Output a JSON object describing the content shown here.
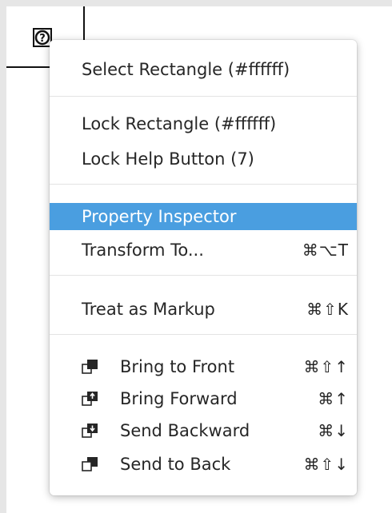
{
  "menu": {
    "items": [
      {
        "label": "Select Rectangle (#ffffff)",
        "shortcut": ""
      },
      {
        "label": "Lock Rectangle (#ffffff)",
        "shortcut": ""
      },
      {
        "label": "Lock Help Button (7)",
        "shortcut": ""
      },
      {
        "label": "Property Inspector",
        "shortcut": ""
      },
      {
        "label": "Transform To...",
        "shortcut": "⌘⌥T"
      },
      {
        "label": "Treat as Markup",
        "shortcut": "⌘⇧K"
      },
      {
        "label": "Bring to Front",
        "shortcut": "⌘⇧↑",
        "icon": "bring-to-front-icon"
      },
      {
        "label": "Bring Forward",
        "shortcut": "⌘↑",
        "icon": "bring-forward-icon"
      },
      {
        "label": "Send Backward",
        "shortcut": "⌘↓",
        "icon": "send-backward-icon"
      },
      {
        "label": "Send to Back",
        "shortcut": "⌘⇧↓",
        "icon": "send-to-back-icon"
      }
    ],
    "highlighted_index": 3
  },
  "canvas": {
    "help_icon": "help-icon"
  },
  "colors": {
    "highlight": "#4a9ee0",
    "text": "#262626",
    "background": "#e6e6e6"
  }
}
